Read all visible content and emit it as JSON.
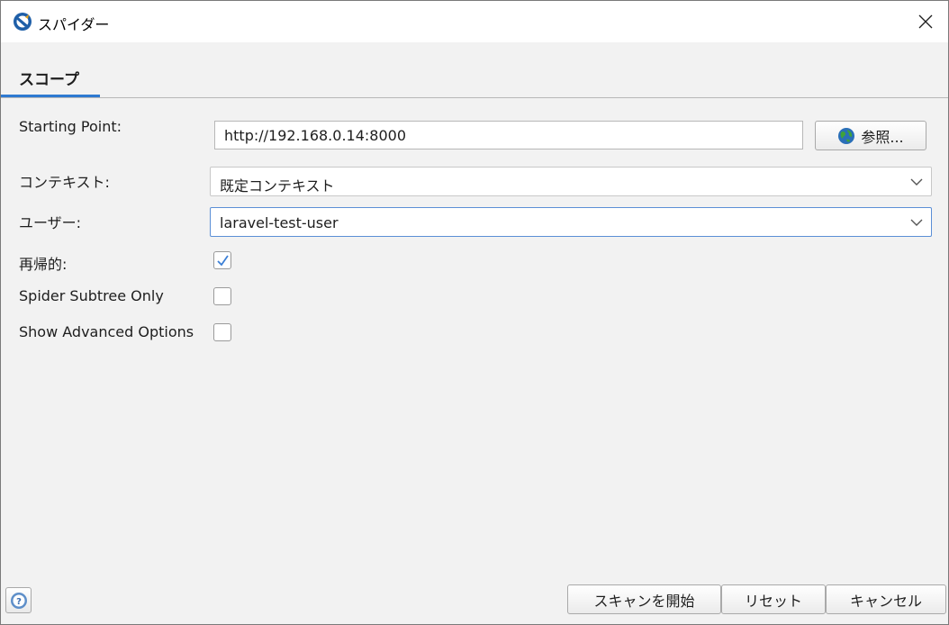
{
  "window": {
    "title": "スパイダー",
    "app_icon": "zap-logo-icon",
    "close_icon": "close-icon"
  },
  "tabs": [
    {
      "label": "スコープ",
      "active": true
    }
  ],
  "form": {
    "starting_point": {
      "label": "Starting Point:",
      "value": "http://192.168.0.14:8000",
      "browse_label": "参照...",
      "browse_icon": "globe-icon"
    },
    "context": {
      "label": "コンテキスト:",
      "value": "既定コンテキスト"
    },
    "user": {
      "label": "ユーザー:",
      "value": "laravel-test-user"
    },
    "recurse": {
      "label": "再帰的:",
      "checked": true
    },
    "subtree_only": {
      "label": "Spider Subtree Only",
      "checked": false
    },
    "advanced": {
      "label": "Show Advanced Options",
      "checked": false
    }
  },
  "footer": {
    "help_icon": "help-icon",
    "start_label": "スキャンを開始",
    "reset_label": "リセット",
    "cancel_label": "キャンセル"
  },
  "colors": {
    "accent": "#2f7ad1",
    "background": "#f2f2f2",
    "check": "#3b7fd6"
  }
}
